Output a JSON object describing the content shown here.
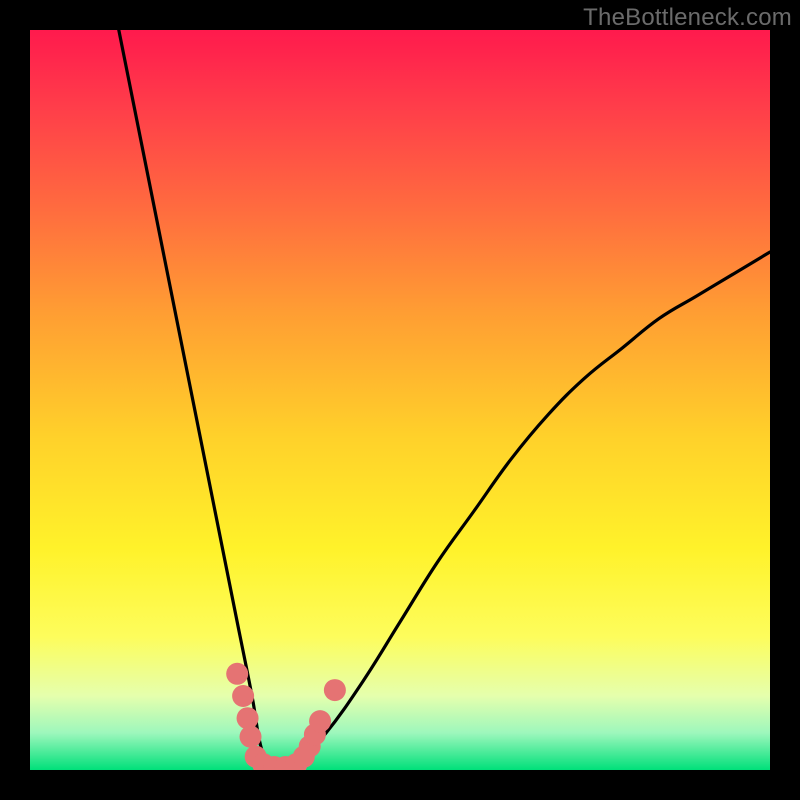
{
  "watermark": "TheBottleneck.com",
  "chart_data": {
    "type": "line",
    "title": "",
    "xlabel": "",
    "ylabel": "",
    "xlim": [
      0,
      100
    ],
    "ylim": [
      0,
      100
    ],
    "series": [
      {
        "name": "bottleneck-curve",
        "x": [
          12,
          14,
          16,
          18,
          20,
          22,
          24,
          26,
          28,
          30,
          31,
          32,
          33,
          34,
          36,
          40,
          45,
          50,
          55,
          60,
          65,
          70,
          75,
          80,
          85,
          90,
          95,
          100
        ],
        "y": [
          100,
          90,
          80,
          70,
          60,
          50,
          40,
          30,
          20,
          10,
          4,
          1,
          0,
          0,
          1,
          5,
          12,
          20,
          28,
          35,
          42,
          48,
          53,
          57,
          61,
          64,
          67,
          70
        ]
      }
    ],
    "markers": {
      "name": "highlight-dots",
      "color": "#e57373",
      "points": [
        {
          "x": 28.0,
          "y": 13.0
        },
        {
          "x": 28.8,
          "y": 10.0
        },
        {
          "x": 29.4,
          "y": 7.0
        },
        {
          "x": 29.8,
          "y": 4.5
        },
        {
          "x": 30.5,
          "y": 1.8
        },
        {
          "x": 31.5,
          "y": 0.8
        },
        {
          "x": 33.0,
          "y": 0.4
        },
        {
          "x": 34.5,
          "y": 0.4
        },
        {
          "x": 36.0,
          "y": 0.8
        },
        {
          "x": 37.0,
          "y": 1.8
        },
        {
          "x": 37.8,
          "y": 3.2
        },
        {
          "x": 38.5,
          "y": 4.8
        },
        {
          "x": 39.2,
          "y": 6.6
        },
        {
          "x": 41.2,
          "y": 10.8
        }
      ]
    }
  }
}
